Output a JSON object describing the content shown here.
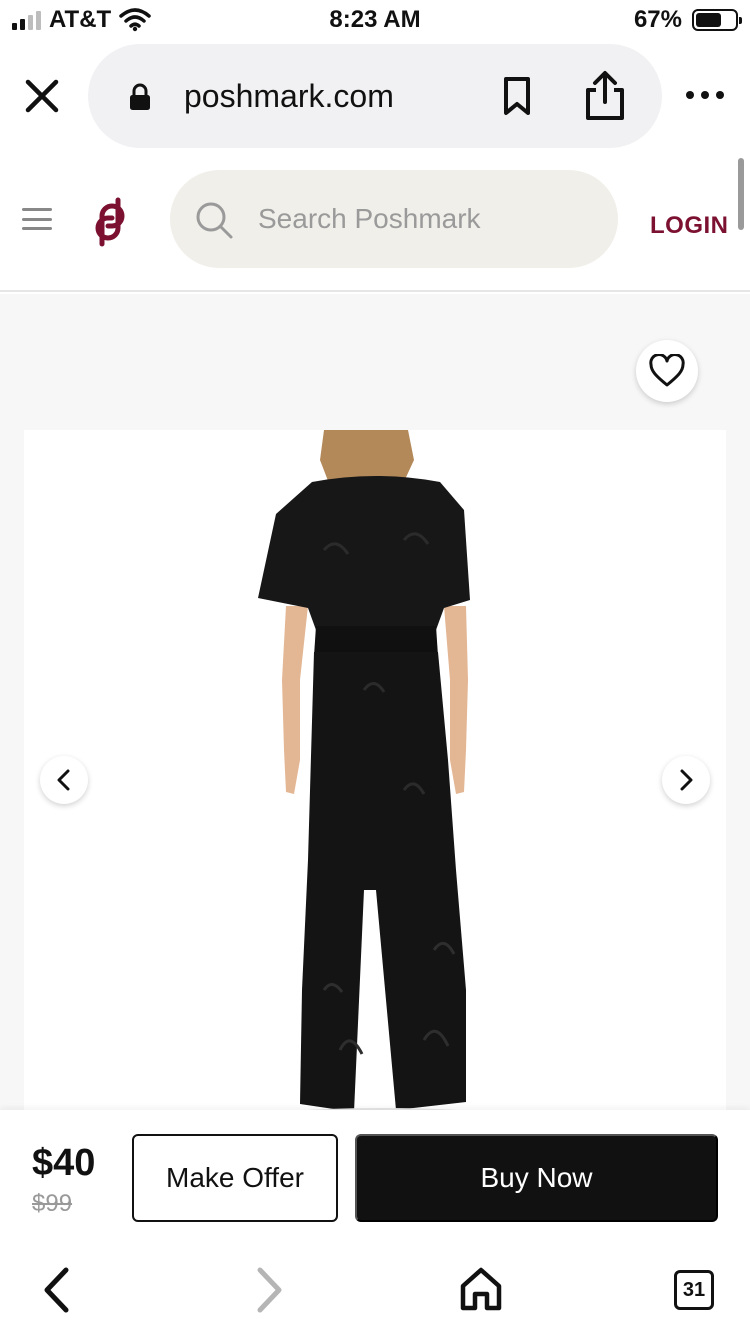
{
  "status_bar": {
    "carrier": "AT&T",
    "time": "8:23 AM",
    "battery": "67%",
    "battery_level": 0.67
  },
  "browser": {
    "url": "poshmark.com",
    "icons": [
      "close-icon",
      "lock-icon",
      "bookmark-icon",
      "share-icon",
      "more-icon"
    ]
  },
  "site_header": {
    "search_placeholder": "Search Poshmark",
    "login_label": "LOGIN",
    "brand_color": "#7b1031"
  },
  "product": {
    "image_alt": "Black lace wide-leg jumpsuit, back view",
    "colors": {
      "garment": "#141414",
      "background": "#ffffff"
    }
  },
  "buy_bar": {
    "price": "$40",
    "original_price": "$99",
    "offer_label": "Make Offer",
    "buy_label": "Buy Now"
  },
  "toolbar": {
    "tabs_count": "31"
  }
}
